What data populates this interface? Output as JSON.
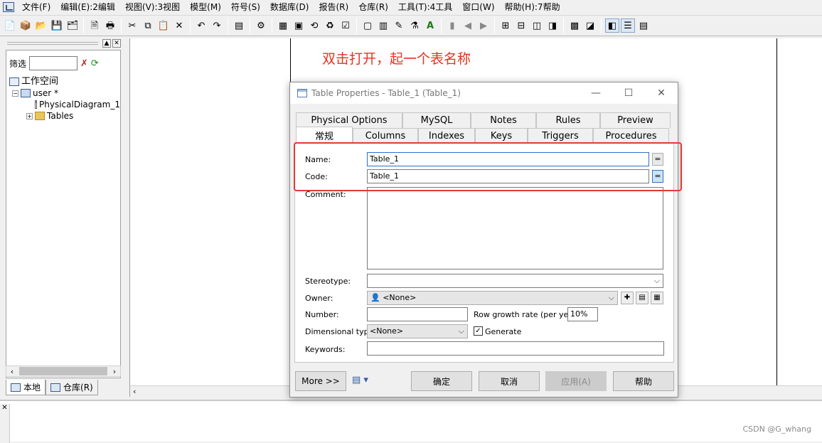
{
  "menu": [
    "文件(F)",
    "编辑(E):2编辑",
    "视图(V):3视图",
    "模型(M)",
    "符号(S)",
    "数据库(D)",
    "报告(R)",
    "仓库(R)",
    "工具(T):4工具",
    "窗口(W)",
    "帮助(H):7帮助"
  ],
  "toolbar": {
    "icons": [
      "new-icon",
      "open-package-icon",
      "open-folder-icon",
      "save-icon",
      "save-all-icon",
      "print-preview-icon",
      "print-icon",
      "cut-icon",
      "copy-icon",
      "paste-icon",
      "delete-icon",
      "undo-icon",
      "redo-icon",
      "properties-icon",
      "check-model-icon",
      "generate-icon",
      "import-icon",
      "reverse-icon",
      "refresh-icon",
      "compare-icon",
      "select-icon",
      "table-icon",
      "pen-icon",
      "format-icon",
      "text-icon",
      "block-icon",
      "arrow-left-icon",
      "arrow-right-icon",
      "window-1-icon",
      "window-2-icon",
      "window-3-icon",
      "window-4-icon",
      "window-5-icon",
      "window-6-icon",
      "toggle-browser-icon",
      "toggle-output-icon",
      "toggle-result-icon"
    ]
  },
  "browser": {
    "filter_label": "筛选",
    "tree": {
      "workspace": "工作空间",
      "model": "user *",
      "diagram": "PhysicalDiagram_1",
      "tables": "Tables"
    },
    "tabs": [
      "本地",
      "仓库(R)"
    ]
  },
  "annotation": "双击打开，起一个表名称",
  "dialog": {
    "title": "Table Properties - Table_1 (Table_1)",
    "tabs_row1": [
      "Physical Options",
      "MySQL",
      "Notes",
      "Rules",
      "Preview"
    ],
    "tabs_row2": [
      "常规",
      "Columns",
      "Indexes",
      "Keys",
      "Triggers",
      "Procedures"
    ],
    "active_tab": "常规",
    "fields": {
      "name_label": "Name:",
      "name_value": "Table_1",
      "code_label": "Code:",
      "code_value": "Table_1",
      "comment_label": "Comment:",
      "stereotype_label": "Stereotype:",
      "owner_label": "Owner:",
      "owner_value": "<None>",
      "number_label": "Number:",
      "row_growth_label": "Row growth rate (per year):",
      "row_growth_value": "10%",
      "dimensional_label": "Dimensional type:",
      "dimensional_value": "<None>",
      "generate_label": "Generate",
      "generate_checked": true,
      "keywords_label": "Keywords:"
    },
    "buttons": {
      "more": "More >>",
      "ok": "确定",
      "cancel": "取消",
      "apply": "应用(A)",
      "help": "帮助"
    }
  },
  "watermark": "CSDN @G_whang",
  "colors": {
    "annotation": "#e8311f",
    "highlight": "#e53935"
  }
}
